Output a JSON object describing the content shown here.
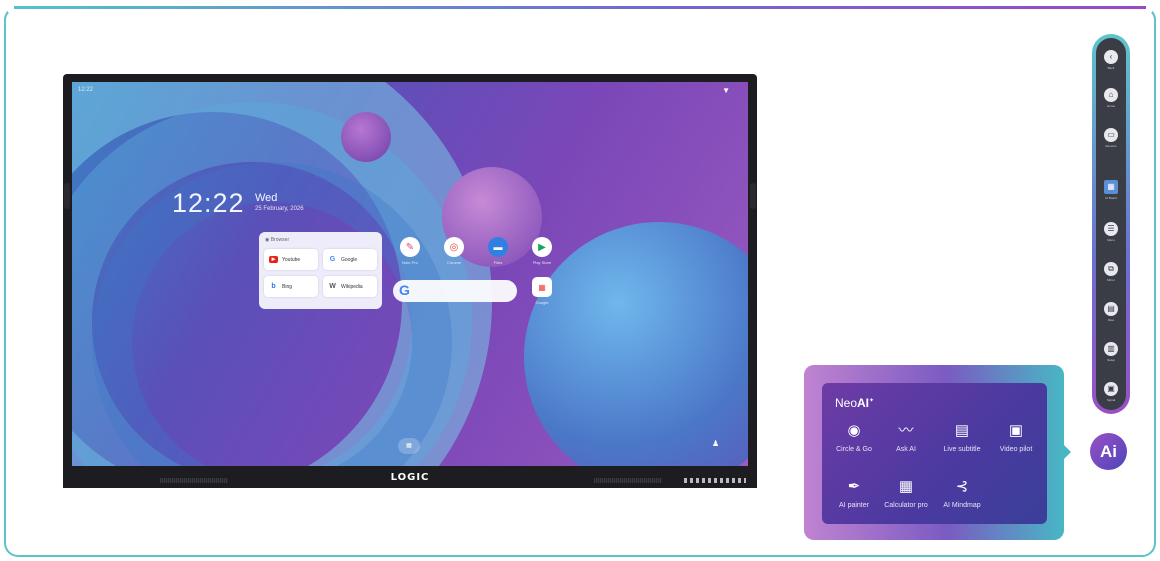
{
  "screen": {
    "status_time": "12:22",
    "clock": "12:22",
    "day": "Wed",
    "date": "25 February, 2026"
  },
  "browser_widget": {
    "title": "Browser",
    "links": [
      "Youtube",
      "Google",
      "Bing",
      "Wikipedia"
    ]
  },
  "apps": [
    {
      "name": "Note Pro",
      "icon": "pen-icon"
    },
    {
      "name": "Chrome",
      "icon": "chrome-icon"
    },
    {
      "name": "Files",
      "icon": "folder-icon"
    },
    {
      "name": "Play Store",
      "icon": "play-icon"
    }
  ],
  "google_app_group": "Google",
  "monitor_brand": "LOGIC",
  "neoai": {
    "title_prefix": "Neo",
    "title_suffix": "AI",
    "tools": [
      {
        "label": "Circle & Go",
        "icon": "circle-go-icon"
      },
      {
        "label": "Ask AI",
        "icon": "ask-ai-icon"
      },
      {
        "label": "Live subtitle",
        "icon": "subtitle-icon"
      },
      {
        "label": "Video pilot",
        "icon": "video-pilot-icon"
      },
      {
        "label": "AI painter",
        "icon": "brush-icon"
      },
      {
        "label": "Calculator pro",
        "icon": "calculator-icon"
      },
      {
        "label": "AI Mindmap",
        "icon": "mindmap-icon"
      }
    ],
    "fab_label": "Ai"
  },
  "toolbar": {
    "items": [
      {
        "label": "Back",
        "icon": "back-icon"
      },
      {
        "label": "Home",
        "icon": "home-icon"
      },
      {
        "label": "Recents",
        "icon": "recents-icon"
      },
      {
        "label": "AI Board",
        "icon": "board-icon"
      },
      {
        "label": "Menu",
        "icon": "menu-icon"
      },
      {
        "label": "Mirror",
        "icon": "mirror-icon"
      },
      {
        "label": "Files",
        "icon": "files-icon"
      },
      {
        "label": "Setup",
        "icon": "setup-icon"
      },
      {
        "label": "Signal",
        "icon": "signal-icon"
      }
    ]
  },
  "colors": {
    "frame": "#5cc3c9",
    "panel_inner": "#4a3aa0",
    "toolbar_bg": "#3b3d46"
  }
}
